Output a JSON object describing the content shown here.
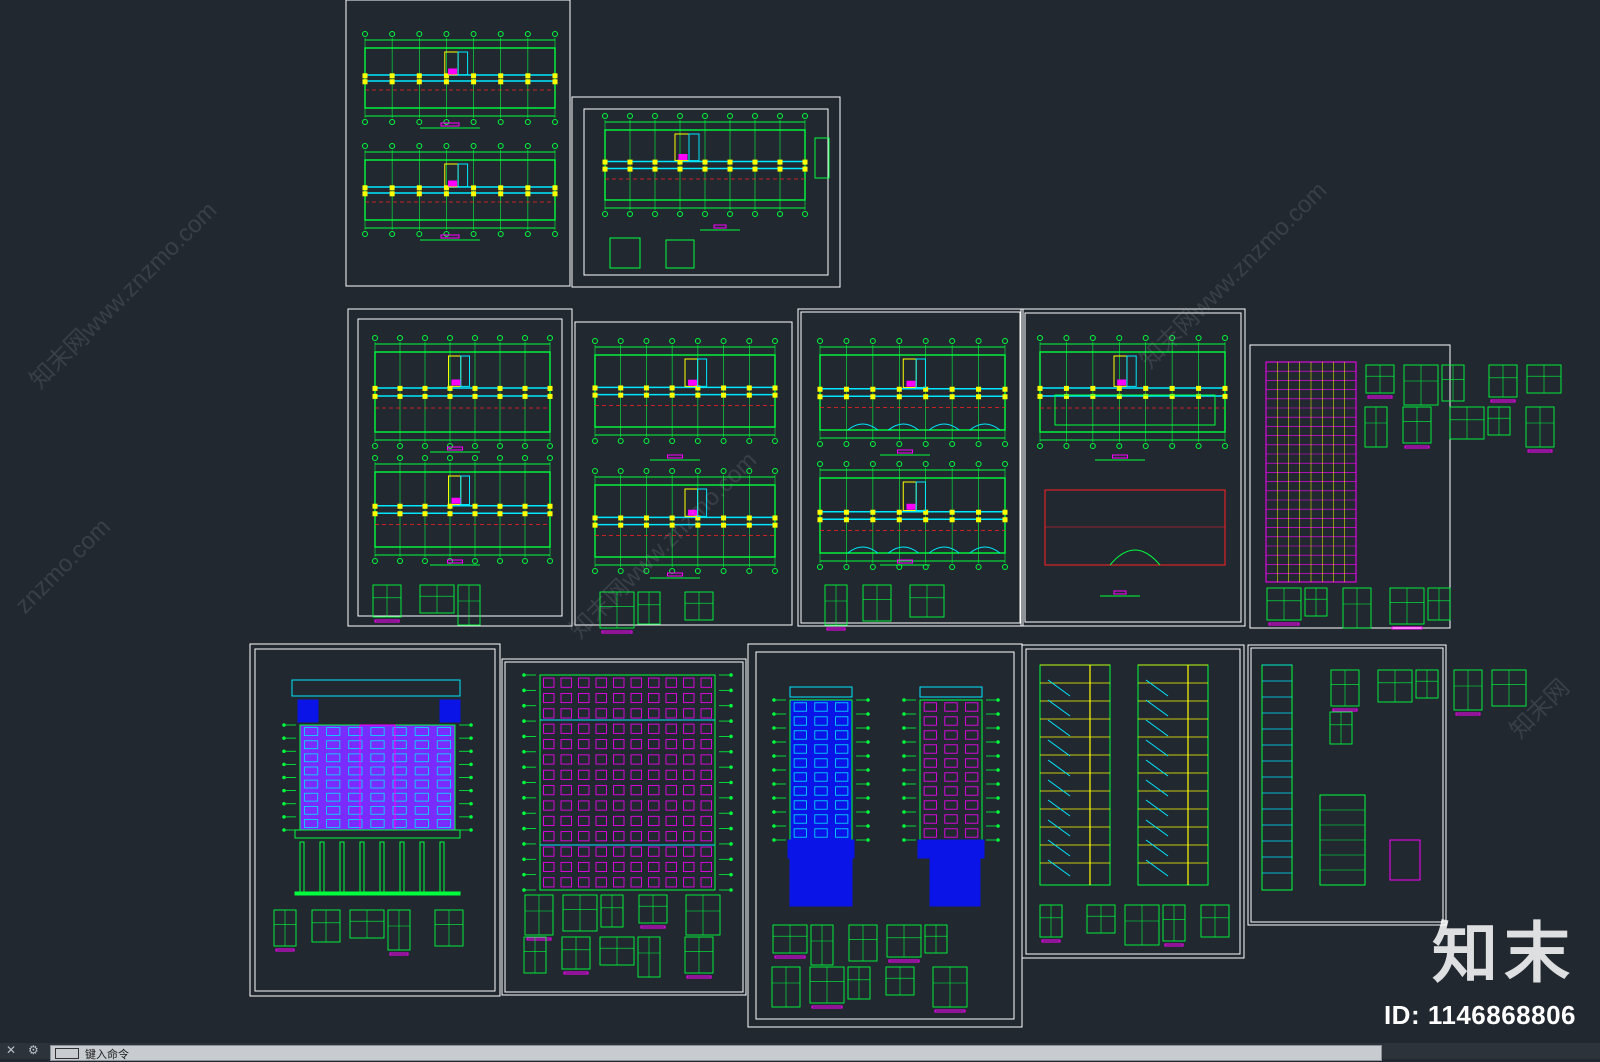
{
  "watermarks": [
    "知末网www.znzmo.com",
    "知末网www.znzmo.com",
    "知末网www.znzmo.com",
    "znzmo.com",
    "知末网"
  ],
  "brand": {
    "logo": "知末",
    "id": "ID: 1146868806"
  },
  "command_line": {
    "placeholder": "键入命令"
  },
  "colors": {
    "background": "#212830",
    "frame": "#ffffff",
    "green": "#00ff3c",
    "cyan": "#00e8ff",
    "magenta": "#ff00ff",
    "yellow": "#ffff00",
    "blue": "#0a14e6",
    "purple": "#7a2cff",
    "red": "#ff2020"
  },
  "sheets": [
    {
      "name": "sheet-floor-plans-1"
    },
    {
      "name": "sheet-floor-plans-2"
    },
    {
      "name": "sheet-floor-plans-3"
    },
    {
      "name": "sheet-floor-plans-4"
    },
    {
      "name": "sheet-floor-plans-5"
    },
    {
      "name": "sheet-roof-plan"
    },
    {
      "name": "sheet-door-window-schedule"
    },
    {
      "name": "sheet-front-elevation"
    },
    {
      "name": "sheet-rear-elevation"
    },
    {
      "name": "sheet-side-elevations"
    },
    {
      "name": "sheet-sections"
    },
    {
      "name": "sheet-details"
    }
  ]
}
